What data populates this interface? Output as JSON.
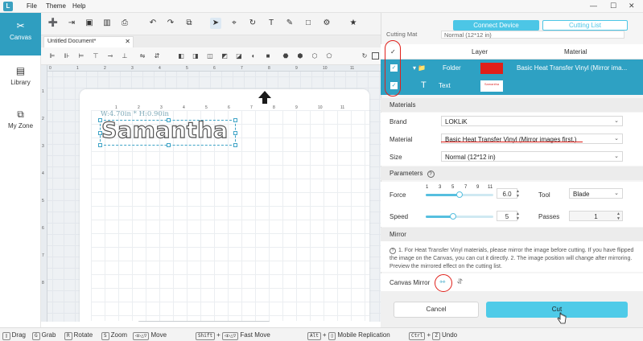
{
  "menubar": {
    "logo": "L",
    "items": [
      "File",
      "Theme",
      "Help"
    ],
    "minimize": "—",
    "maximize": "☐",
    "close": "✕"
  },
  "leftnav": [
    {
      "icon": "✂",
      "label": "Canvas",
      "active": true
    },
    {
      "icon": "▤",
      "label": "Library",
      "active": false
    },
    {
      "icon": "⧉",
      "label": "My Zone",
      "active": false
    }
  ],
  "toolbar": {
    "icons": [
      "➕",
      "⇥",
      "▣",
      "▥",
      "⎙",
      "↶",
      "↷",
      "⧉",
      "➤",
      "⌖",
      "↻",
      "T",
      "✎",
      "□",
      "⚙",
      "★"
    ]
  },
  "document_tab": {
    "title": "Untitled Document*",
    "close": "✕"
  },
  "canvas": {
    "ruler_top": [
      "0",
      "1",
      "2",
      "3",
      "4",
      "5",
      "6",
      "7",
      "8",
      "9",
      "10",
      "11"
    ],
    "ruler_mat": [
      "1",
      "2",
      "3",
      "4",
      "5",
      "6",
      "7",
      "8",
      "9",
      "10",
      "11"
    ],
    "ruler_left": [
      "1",
      "2",
      "3",
      "4",
      "5",
      "6",
      "7",
      "8"
    ],
    "dimension_label": "W:4.70in * H:0.90in",
    "design_text": "Samantha"
  },
  "statusbar": {
    "items": [
      {
        "key": "",
        "label": "Drag"
      },
      {
        "key": "G",
        "label": "Grab"
      },
      {
        "key": "R",
        "label": "Rotate"
      },
      {
        "key": "S",
        "label": "Zoom"
      },
      {
        "key": "Shift",
        "label": "+"
      },
      {
        "key": "",
        "label": "Move"
      },
      {
        "key": "Shift",
        "label": "+"
      },
      {
        "key": "",
        "label": "Fast Move"
      },
      {
        "key": "Alt",
        "label": "+"
      },
      {
        "key": "",
        "label": "Mobile Replication"
      },
      {
        "key": "Ctrl",
        "label": "+"
      },
      {
        "key": "Z",
        "label": "Undo"
      }
    ]
  },
  "panel": {
    "connect_label": "Connect Device",
    "cutting_list_label": "Cutting List",
    "cutting_mat_label": "Cutting Mat",
    "cutting_mat_value": "Normal (12*12 in)",
    "layer_header": {
      "check": "✓",
      "layer": "Layer",
      "material": "Material"
    },
    "layers": [
      {
        "name": "Folder",
        "material": "Basic Heat Transfer Vinyl (Mirror ima...",
        "swatch": "#e0201a",
        "icon": "▾ 📁"
      },
      {
        "name": "Text",
        "material": "",
        "swatch": "#ffffff",
        "swatch_text": "Samantha",
        "icon": "T"
      }
    ],
    "materials_title": "Materials",
    "brand_label": "Brand",
    "brand_value": "LOKLiK",
    "material_label": "Material",
    "material_value": "Basic Heat Transfer Vinyl (Mirror images first.)",
    "size_label": "Size",
    "size_value": "Normal (12*12 in)",
    "parameters_title": "Parameters",
    "parameters_info": "?",
    "force_label": "Force",
    "force_ticks": [
      "1",
      "3",
      "5",
      "7",
      "9",
      "11"
    ],
    "force_value": "6.0",
    "force_level": 0.5,
    "tool_label": "Tool",
    "tool_value": "Blade",
    "speed_label": "Speed",
    "speed_value": "5",
    "speed_level": 0.4,
    "passes_label": "Passes",
    "passes_value": "1",
    "mirror_title": "Mirror",
    "mirror_note": "1. For Heat Transfer Vinyl materials, please mirror the image before cutting. If you have flipped the image on the Canvas, you can cut it directly. 2. The image position will change after mirroring. Preview the mirrored effect on the cutting list.",
    "canvas_mirror_label": "Canvas Mirror",
    "cancel_label": "Cancel",
    "cut_label": "Cut"
  },
  "colors": {
    "accent": "#2ea1c3",
    "button": "#4fcbe8",
    "annotation": "#e0201a"
  }
}
